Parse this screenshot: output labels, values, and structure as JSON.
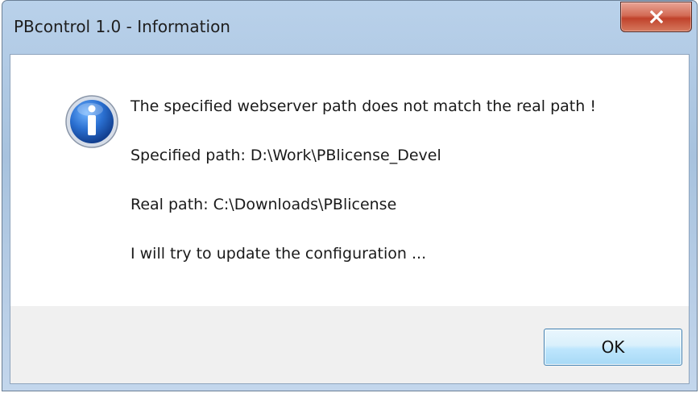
{
  "window": {
    "title": "PBcontrol 1.0 - Information",
    "close_icon": "close-icon"
  },
  "dialog": {
    "icon": "info-icon",
    "messages": [
      "The specified webserver path does not match the real path !",
      "Specified path: D:\\Work\\PBlicense_Devel",
      "Real path: C:\\Downloads\\PBlicense",
      "I will try to update the configuration ..."
    ]
  },
  "buttons": {
    "ok_label": "OK"
  },
  "colors": {
    "titlebar": "#b9d1ea",
    "close_button": "#c0422b",
    "info_icon": "#1c5fb8",
    "button_border": "#3c7fb1"
  }
}
